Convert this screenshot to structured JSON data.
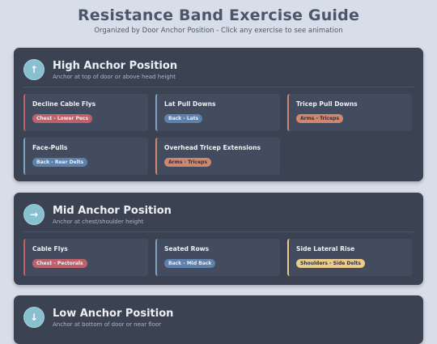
{
  "page": {
    "title": "Resistance Band Exercise Guide",
    "subtitle": "Organized by Door Anchor Position - Click any exercise to see animation"
  },
  "sections": {
    "high": {
      "icon": "arrow-up-icon",
      "title": "High Anchor Position",
      "desc": "Anchor at top of door or above head height",
      "cards": [
        {
          "name": "Decline Cable Flys",
          "tag": "Chest - Lower Pecs"
        },
        {
          "name": "Lat Pull Downs",
          "tag": "Back - Lats"
        },
        {
          "name": "Tricep Pull Downs",
          "tag": "Arms - Triceps"
        },
        {
          "name": "Face-Pulls",
          "tag": "Back - Rear Delts"
        },
        {
          "name": "Overhead Tricep Extensions",
          "tag": "Arms - Triceps"
        }
      ]
    },
    "mid": {
      "icon": "arrow-right-icon",
      "title": "Mid Anchor Position",
      "desc": "Anchor at chest/shoulder height",
      "cards": [
        {
          "name": "Cable Flys",
          "tag": "Chest - Pectorals"
        },
        {
          "name": "Seated Rows",
          "tag": "Back - Mid Back"
        },
        {
          "name": "Side Lateral Rise",
          "tag": "Shoulders - Side Delts"
        }
      ]
    },
    "low": {
      "icon": "arrow-down-icon",
      "title": "Low Anchor Position",
      "desc": "Anchor at bottom of door or near floor"
    }
  },
  "colors": {
    "chest": "#bf616a",
    "back": "#5e81ac",
    "arms": "#d08770",
    "shoulders": "#ebcb8b",
    "section_bg": "#3b4252",
    "card_bg": "#434c5e"
  }
}
